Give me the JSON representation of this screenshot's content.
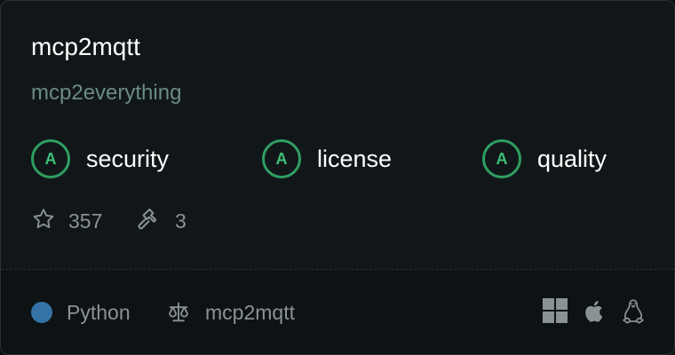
{
  "server": {
    "name": "mcp2mqtt",
    "owner": "mcp2everything"
  },
  "grades": [
    {
      "letter": "A",
      "label": "security"
    },
    {
      "letter": "A",
      "label": "license"
    },
    {
      "letter": "A",
      "label": "quality"
    }
  ],
  "stats": {
    "stars": "357",
    "tools": "3"
  },
  "footer": {
    "language": "Python",
    "language_color": "#3572a5",
    "license": "mcp2mqtt",
    "platforms": [
      "windows-icon",
      "apple-icon",
      "linux-icon"
    ]
  },
  "colors": {
    "grade_ring": "#2f9e61",
    "grade_letter": "#3fbf78",
    "owner_text": "#6b8a86",
    "muted_text": "#8a9295"
  }
}
